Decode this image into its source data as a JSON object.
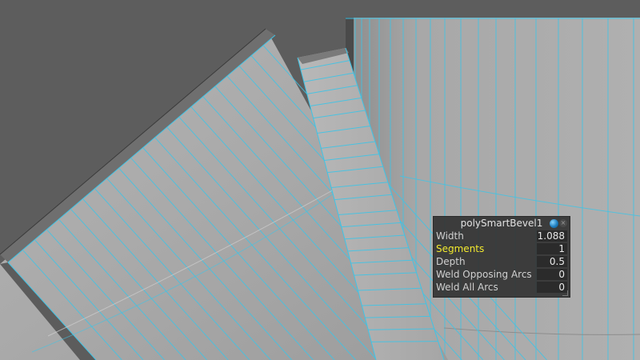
{
  "viewport": {
    "background_color": "#5d5d5d",
    "wire_color": "#3fc4e6"
  },
  "hud": {
    "title": "polySmartBevel1",
    "icons": [
      "component-sphere-icon",
      "close-icon"
    ],
    "rows": [
      {
        "label": "Width",
        "value": "1.088",
        "active": false
      },
      {
        "label": "Segments",
        "value": "1",
        "active": true
      },
      {
        "label": "Depth",
        "value": "0.5",
        "active": false
      },
      {
        "label": "Weld Opposing Arcs",
        "value": "0",
        "active": false
      },
      {
        "label": "Weld All Arcs",
        "value": "0",
        "active": false
      }
    ],
    "active_label_color": "#f3ea2e"
  },
  "cursor": {
    "icon": "drag-horizontal-cursor-icon"
  }
}
